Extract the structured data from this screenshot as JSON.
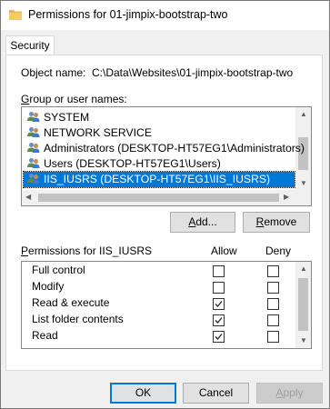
{
  "window": {
    "title": "Permissions for 01-jimpix-bootstrap-two",
    "tab_security": "Security"
  },
  "object": {
    "label": "Object name:",
    "value": "C:\\Data\\Websites\\01-jimpix-bootstrap-two"
  },
  "group_list": {
    "label": "Group or user names:",
    "items": [
      {
        "label": "SYSTEM",
        "selected": false
      },
      {
        "label": "NETWORK SERVICE",
        "selected": false
      },
      {
        "label": "Administrators (DESKTOP-HT57EG1\\Administrators)",
        "selected": false
      },
      {
        "label": "Users (DESKTOP-HT57EG1\\Users)",
        "selected": false
      },
      {
        "label": "IIS_IUSRS (DESKTOP-HT57EG1\\IIS_IUSRS)",
        "selected": true
      }
    ]
  },
  "buttons": {
    "add": "Add...",
    "remove": "Remove",
    "ok": "OK",
    "cancel": "Cancel",
    "apply": "Apply"
  },
  "permissions": {
    "label": "Permissions for IIS_IUSRS",
    "allow_header": "Allow",
    "deny_header": "Deny",
    "rows": [
      {
        "name": "Full control",
        "allow": false,
        "deny": false
      },
      {
        "name": "Modify",
        "allow": false,
        "deny": false
      },
      {
        "name": "Read & execute",
        "allow": true,
        "deny": false
      },
      {
        "name": "List folder contents",
        "allow": true,
        "deny": false
      },
      {
        "name": "Read",
        "allow": true,
        "deny": false
      }
    ]
  },
  "icons": {
    "title": "folder-icon",
    "user": "user-group-icon",
    "check": "checkmark-icon"
  }
}
